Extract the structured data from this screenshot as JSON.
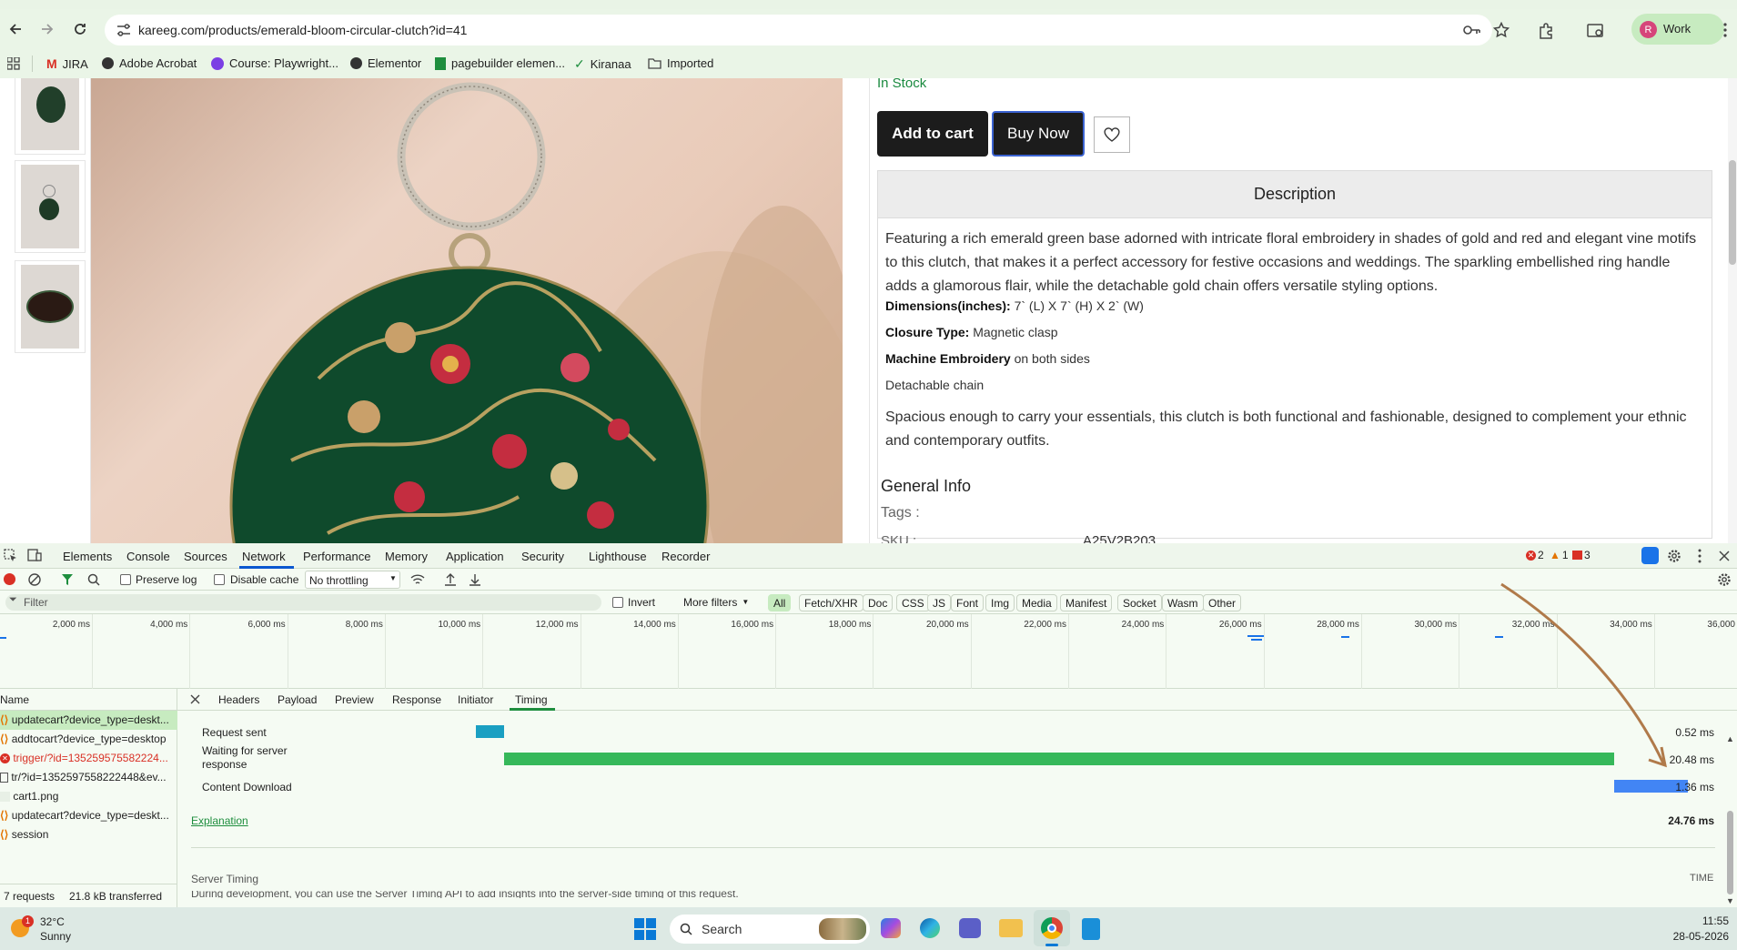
{
  "browser": {
    "url": "kareeg.com/products/emerald-bloom-circular-clutch?id=41",
    "profile_label": "Work",
    "profile_initial": "R",
    "bookmarks": [
      "JIRA",
      "Adobe Acrobat",
      "Course: Playwright...",
      "Elementor",
      "pagebuilder elemen...",
      "Kiranaa",
      "Imported"
    ]
  },
  "product": {
    "stock_status": "In Stock",
    "add_to_cart": "Add to cart",
    "buy_now": "Buy Now",
    "description_heading": "Description",
    "description_para1": "Featuring a rich emerald green base adorned with intricate floral embroidery in shades of gold and red and elegant vine motifs to this clutch, that makes it a perfect accessory for festive occasions and weddings. The sparkling embellished ring handle adds a glamorous flair, while the detachable gold chain offers versatile styling options.",
    "dimensions_label": "Dimensions(inches):",
    "dimensions_value": " 7` (L) X 7` (H) X 2` (W)",
    "closure_label": "Closure Type:",
    "closure_value": " Magnetic clasp",
    "embroidery_label": "Machine Embroidery",
    "embroidery_value": " on both sides",
    "chain_text": "Detachable chain",
    "description_para2": "Spacious enough to carry your essentials, this clutch is both functional and fashionable, designed to complement your ethnic and contemporary outfits.",
    "general_info": "General Info",
    "tags_label": "Tags :",
    "sku_label": "SKU :",
    "sku_value": "A25V2B203"
  },
  "devtools": {
    "tabs": [
      "Elements",
      "Console",
      "Sources",
      "Network",
      "Performance",
      "Memory",
      "Application",
      "Security",
      "Lighthouse",
      "Recorder"
    ],
    "active_tab": "Network",
    "errors": "2",
    "warnings": "1",
    "issues": "3",
    "preserve_log": "Preserve log",
    "disable_cache": "Disable cache",
    "throttling": "No throttling",
    "filter_placeholder": "Filter",
    "invert": "Invert",
    "more_filters": "More filters",
    "type_filters": [
      "All",
      "Fetch/XHR",
      "Doc",
      "CSS",
      "JS",
      "Font",
      "Img",
      "Media",
      "Manifest",
      "Socket",
      "Wasm",
      "Other"
    ],
    "timeline_ticks": [
      "2,000 ms",
      "4,000 ms",
      "6,000 ms",
      "8,000 ms",
      "10,000 ms",
      "12,000 ms",
      "14,000 ms",
      "16,000 ms",
      "18,000 ms",
      "20,000 ms",
      "22,000 ms",
      "24,000 ms",
      "26,000 ms",
      "28,000 ms",
      "30,000 ms",
      "32,000 ms",
      "34,000 ms",
      "36,000 ms"
    ],
    "name_header": "Name",
    "requests": [
      {
        "name": "updatecart?device_type=deskt...",
        "kind": "xhr",
        "status": "selected"
      },
      {
        "name": "addtocart?device_type=desktop",
        "kind": "xhr",
        "status": "ok"
      },
      {
        "name": "trigger/?id=135259575582224...",
        "kind": "error",
        "status": "failed"
      },
      {
        "name": "tr/?id=1352597558222448&ev...",
        "kind": "doc",
        "status": "ok"
      },
      {
        "name": "cart1.png",
        "kind": "img",
        "status": "ok"
      },
      {
        "name": "updatecart?device_type=deskt...",
        "kind": "xhr",
        "status": "ok"
      },
      {
        "name": "session",
        "kind": "xhr",
        "status": "ok"
      }
    ],
    "requests_count": "7 requests",
    "transferred": "21.8 kB transferred",
    "detail_tabs": [
      "Headers",
      "Payload",
      "Preview",
      "Response",
      "Initiator",
      "Timing"
    ],
    "active_detail_tab": "Timing",
    "timing": [
      {
        "label": "Request sent",
        "value": "0.52 ms",
        "color": "#1a9fc2"
      },
      {
        "label": "Waiting for server response",
        "value": "20.48 ms",
        "color": "#36b85a"
      },
      {
        "label": "Content Download",
        "value": "1.36 ms",
        "color": "#4285f4"
      }
    ],
    "explanation": "Explanation",
    "total": "24.76 ms",
    "server_timing": "Server Timing",
    "time_header": "TIME",
    "server_timing_note": "During development, you can use the Server Timing API to add insights into the server-side timing of this request."
  },
  "taskbar": {
    "weather_temp": "32°C",
    "weather_desc": "Sunny",
    "weather_badge": "1",
    "search_label": "Search",
    "time": "11:55",
    "date": "28-05-2026"
  },
  "colors": {
    "chrome_bg": "#eaf5e7",
    "accent_green": "#36b85a",
    "link_blue": "#0b57d0",
    "error_red": "#d93025",
    "annotation_arrow": "#b07a4a"
  }
}
